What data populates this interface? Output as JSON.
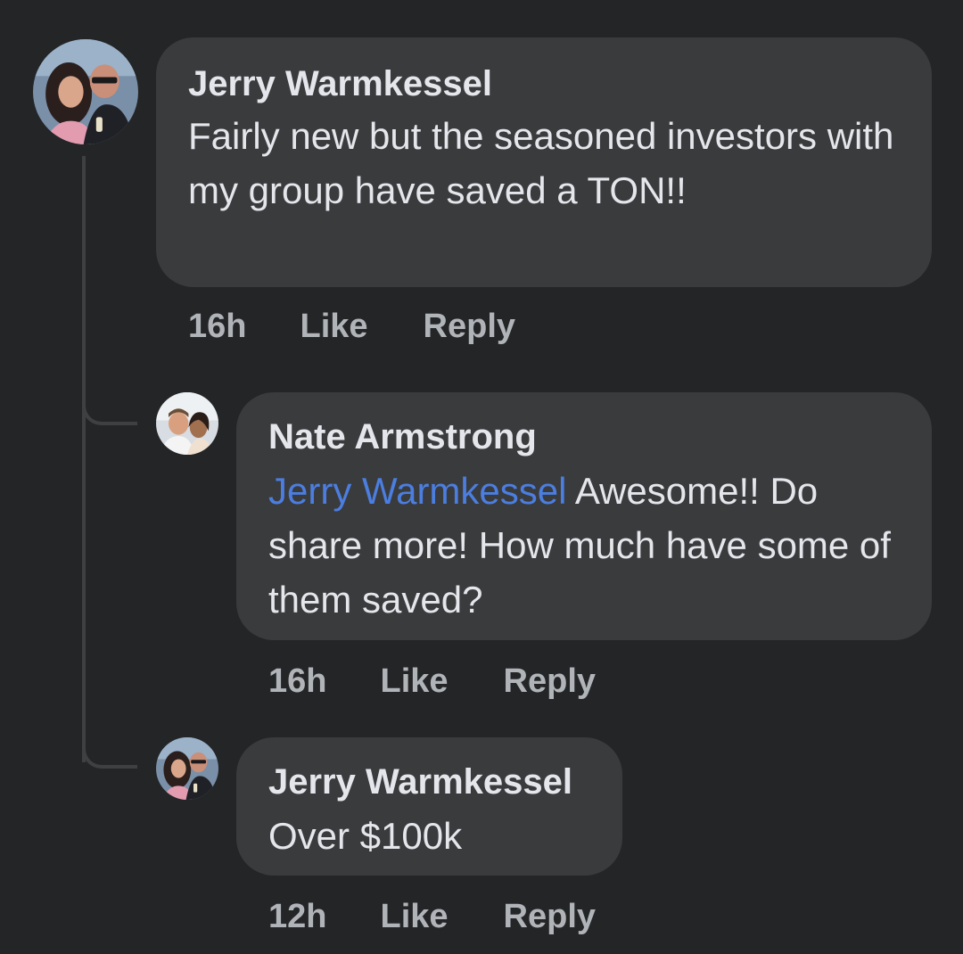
{
  "comments": [
    {
      "author": "Jerry Warmkessel",
      "text": "Fairly new but the seasoned investors with my group have saved a TON!!",
      "time": "16h",
      "like_label": "Like",
      "reply_label": "Reply"
    },
    {
      "author": "Nate Armstrong",
      "mention": "Jerry Warmkessel",
      "text": " Awesome!! Do share more! How much have some of them saved?",
      "time": "16h",
      "like_label": "Like",
      "reply_label": "Reply"
    },
    {
      "author": "Jerry Warmkessel",
      "text": "Over $100k",
      "time": "12h",
      "like_label": "Like",
      "reply_label": "Reply"
    }
  ],
  "colors": {
    "background": "#242526",
    "bubble": "#3a3b3c",
    "mention": "#4b7ee0",
    "meta_text": "#b0b3b8"
  }
}
